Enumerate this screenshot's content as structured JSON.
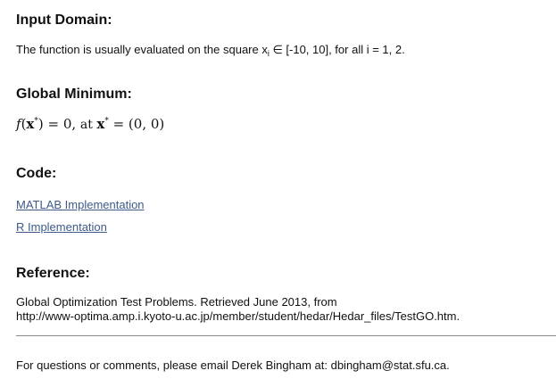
{
  "input_domain": {
    "heading": "Input Domain:",
    "text_before": "The function is usually evaluated on the square x",
    "subscript": "i",
    "text_after": " ∈ [-10, 10], for all i = 1, 2."
  },
  "global_minimum": {
    "heading": "Global Minimum:",
    "f": "f",
    "x_bold": "x",
    "star": "*",
    "eq_value": ") = 0, ",
    "at": "at ",
    "x_bold_2": "x",
    "star_2": "*",
    "point": " = (0, 0)"
  },
  "code": {
    "heading": "Code:",
    "matlab_link": "MATLAB Implementation",
    "r_link": "R Implementation"
  },
  "reference": {
    "heading": "Reference:",
    "line1": "Global Optimization Test Problems. Retrieved June 2013, from",
    "line2": "http://www-optima.amp.i.kyoto-u.ac.jp/member/student/hedar/Hedar_files/TestGO.htm."
  },
  "footer": {
    "text": "For questions or comments, please email Derek Bingham at: dbingham@stat.sfu.ca."
  }
}
